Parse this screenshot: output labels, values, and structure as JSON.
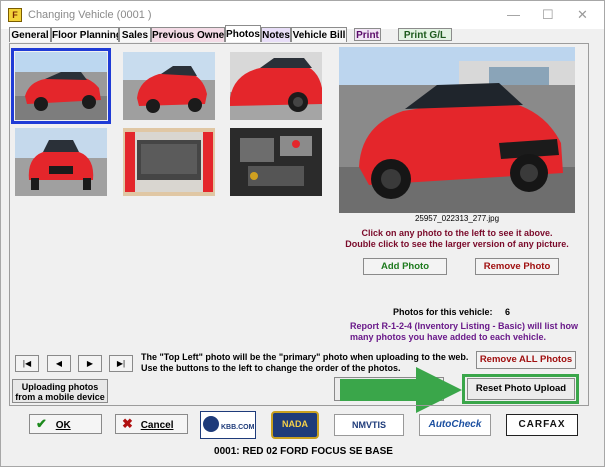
{
  "window": {
    "title": "Changing Vehicle  (0001     )",
    "app_icon_glyph": "F",
    "minimize_glyph": "—",
    "maximize_glyph": "☐",
    "close_glyph": "✕"
  },
  "tabs": [
    {
      "label": "General",
      "style": "plain"
    },
    {
      "label": "Floor Planning",
      "style": "plain"
    },
    {
      "label": "Sales",
      "style": "plain"
    },
    {
      "label": "Previous Owner",
      "style": "pink"
    },
    {
      "label": "Photos",
      "style": "active"
    },
    {
      "label": "Notes",
      "style": "lav"
    },
    {
      "label": "Vehicle Bill",
      "style": "plain"
    }
  ],
  "print_buttons": {
    "print": "Print",
    "print_gl": "Print G/L"
  },
  "photos": {
    "main_filename": "25957_022313_277.jpg",
    "instructions_line1": "Click on any photo to the left to see it above.",
    "instructions_line2": "Double click to see the larger version of any picture.",
    "add_photo": "Add Photo",
    "remove_photo": "Remove Photo",
    "count_label": "Photos for this vehicle:",
    "count_value": "6",
    "report_note": "Report R-1-2-4 (Inventory Listing - Basic) will list how many photos you have added to each vehicle.",
    "remove_all": "Remove ALL Photos",
    "reset_upload": "Reset Photo Upload",
    "primary_note_line1": "The \"Top Left\" photo will be the \"primary\" photo when uploading to the web.",
    "primary_note_line2": "Use the buttons to the left to change the order of the photos.",
    "mobile_upload": "Uploading photos from a mobile device",
    "order_buttons": [
      "|◀",
      "◀",
      "▶",
      "▶|"
    ],
    "thumbnails": [
      "front-three-quarter",
      "rear-three-quarter",
      "side",
      "front",
      "cargo-area",
      "engine-bay"
    ]
  },
  "footer": {
    "ok_label": "OK",
    "ok_icon": "✔",
    "cancel_label": "Cancel",
    "cancel_icon": "✖",
    "logos": {
      "kbb": "KBB.COM",
      "nada": "NADA",
      "nmvtis": "NMVTIS",
      "autocheck": "AutoCheck",
      "carfax": "CARFAX"
    },
    "status": "0001: RED 02 FORD FOCUS SE BASE"
  },
  "colors": {
    "accent_green": "#1d7a1d",
    "accent_red": "#a01010",
    "selected_border": "#1f3bd6",
    "highlight": "#3aa64a",
    "car_red": "#e4262b"
  }
}
